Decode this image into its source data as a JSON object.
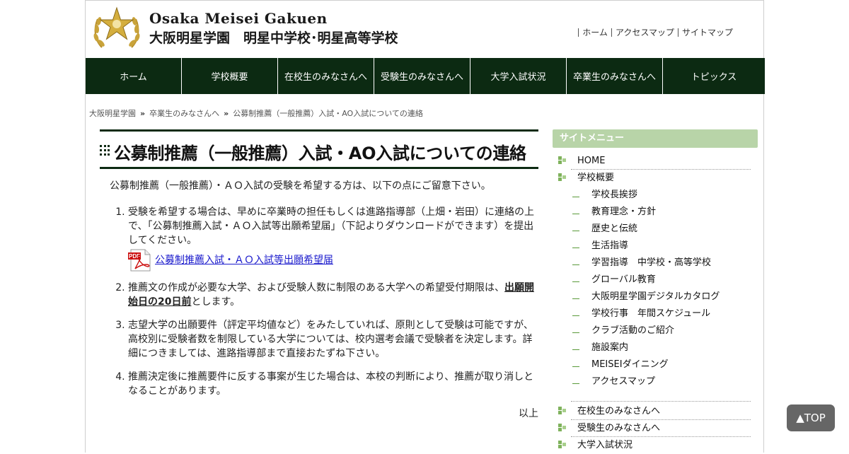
{
  "header": {
    "logo_en": "Osaka Meisei Gakuen",
    "logo_ja": "大阪明星学園　明星中学校･明星高等学校",
    "links": [
      "ホーム",
      "アクセスマップ",
      "サイトマップ"
    ]
  },
  "nav": [
    "ホーム",
    "学校概要",
    "在校生のみなさんへ",
    "受験生のみなさんへ",
    "大学入試状況",
    "卒業生のみなさんへ",
    "トピックス"
  ],
  "breadcrumb": [
    "大阪明星学園",
    "卒業生のみなさんへ",
    "公募制推薦（一般推薦）入試・AO入試についての連絡"
  ],
  "breadcrumb_sep": "»",
  "main": {
    "title": "公募制推薦（一般推薦）入試・AO入試についての連絡",
    "intro": "公募制推薦（一般推薦）・ＡＯ入試の受験を希望する方は、以下の点にご留意下さい。",
    "item1": "受験を希望する場合は、早めに卒業時の担任もしくは進路指導部（上畑・岩田）に連絡の上で、「公募制推薦入試・ＡＯ入試等出願希望届」（下記よりダウンロードができます）を提出してください。",
    "pdf_link": "公募制推薦入試・ＡＯ入試等出願希望届",
    "item2_pre": "推薦文の作成が必要な大学、および受験人数に制限のある大学への希望受付期限は、",
    "item2_bold": "出願開始日の20日前",
    "item2_post": "とします。",
    "item3": "志望大学の出願要件（評定平均値など）をみたしていれば、原則として受験は可能ですが、高校別に受験者数を制限している大学については、校内選考会議で受験者を決定します。詳細につきましては、進路指導部まで直接おたずね下さい。",
    "item4": "推薦決定後に推薦要件に反する事案が生じた場合は、本校の判断により、推薦が取り消しとなることがあります。",
    "closing": "以上"
  },
  "sidebar": {
    "heading": "サイトメニュー",
    "top1": "HOME",
    "top2": "学校概要",
    "subs": [
      "学校長挨拶",
      "教育理念・方針",
      "歴史と伝統",
      "生活指導",
      "学習指導　中学校・高等学校",
      "グローバル教育",
      "大阪明星学園デジタルカタログ",
      "学校行事　年間スケジュール",
      "クラブ活動のご紹介",
      "施設案内",
      "MEISEIダイニング",
      "アクセスマップ"
    ],
    "top3": "在校生のみなさんへ",
    "top4": "受験生のみなさんへ",
    "top5": "大学入試状況"
  },
  "top_button": "▲TOP",
  "colors": {
    "nav_bg": "#0c2a12",
    "sidebar_head": "#b8d4a8",
    "accent_green": "#5a9a3a"
  }
}
